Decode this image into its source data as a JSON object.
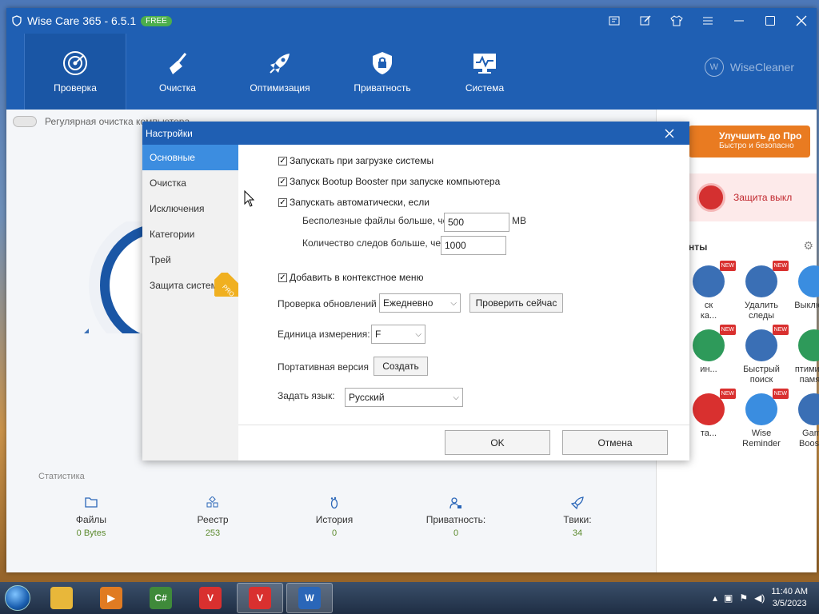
{
  "app": {
    "title": "Wise Care 365 - 6.5.1",
    "badge": "FREE",
    "brand": "WiseCleaner",
    "nav": [
      {
        "label": "Проверка",
        "icon": "radar-icon"
      },
      {
        "label": "Очистка",
        "icon": "broom-icon"
      },
      {
        "label": "Оптимизация",
        "icon": "rocket-icon"
      },
      {
        "label": "Приватность",
        "icon": "lock-shield-icon"
      },
      {
        "label": "Система",
        "icon": "monitor-icon"
      }
    ],
    "toggle_label": "Регулярная очистка компьютера",
    "stats_title": "Статистика",
    "stats": [
      {
        "label": "Файлы",
        "value": "0 Bytes",
        "icon": "folder-icon"
      },
      {
        "label": "Реестр",
        "value": "253",
        "icon": "registry-icon"
      },
      {
        "label": "История",
        "value": "0",
        "icon": "footprint-icon"
      },
      {
        "label": "Приватность:",
        "value": "0",
        "icon": "user-lock-icon"
      },
      {
        "label": "Твики:",
        "value": "34",
        "icon": "rocket-icon"
      }
    ],
    "upgrade": {
      "main": "Улучшить до Про",
      "sub": "Быстро и безопасно"
    },
    "protection": "Защита выкл",
    "tools_title": "нты",
    "tools": [
      {
        "label": "ск\nка...",
        "color": "#3a6fb5"
      },
      {
        "label": "Удалить\nследы",
        "color": "#3a6fb5"
      },
      {
        "label": "Выключ...",
        "color": "#3a8de0"
      },
      {
        "label": "ин...",
        "color": "#2e9a5a"
      },
      {
        "label": "Быстрый\nпоиск",
        "color": "#3a6fb5"
      },
      {
        "label": "птимизац\nпамяти",
        "color": "#2e9a5a"
      },
      {
        "label": "та...",
        "color": "#d9302f"
      },
      {
        "label": "Wise\nReminder",
        "color": "#3a8de0"
      },
      {
        "label": "Game\nBooster",
        "color": "#3a6fb5"
      }
    ],
    "new_badge": "NEW"
  },
  "dialog": {
    "title": "Настройки",
    "sidebar": [
      "Основные",
      "Очистка",
      "Исключения",
      "Категории",
      "Трей",
      "Защита системы"
    ],
    "pro_badge": "PRO",
    "options": {
      "startup": "Запускать при загрузке системы",
      "bootup_booster": "Запуск Bootup Booster при запуске компьютера",
      "auto_run": "Запускать автоматически, если",
      "junk_label": "Бесполезные файлы больше, чем",
      "junk_value": "500",
      "junk_unit": "MB",
      "traces_label": "Количество следов больше, чем",
      "traces_value": "1000",
      "context_menu": "Добавить в контекстное меню",
      "updates_label": "Проверка обновлений",
      "updates_value": "Ежедневно",
      "check_now": "Проверить сейчас",
      "unit_label": "Единица измерения:",
      "unit_value": "F",
      "portable_label": "Портативная версия",
      "create": "Создать",
      "lang_label": "Задать язык:",
      "lang_value": "Русский"
    },
    "ok": "OK",
    "cancel": "Отмена"
  },
  "taskbar": {
    "apps": [
      {
        "name": "explorer",
        "color": "#e8b73a",
        "glyph": ""
      },
      {
        "name": "media-player",
        "color": "#e07b22",
        "glyph": "▶"
      },
      {
        "name": "csharp",
        "color": "#3f8a3a",
        "glyph": "C#"
      },
      {
        "name": "vivaldi",
        "color": "#d9302f",
        "glyph": "V"
      },
      {
        "name": "vivaldi-2",
        "color": "#d9302f",
        "glyph": "V"
      },
      {
        "name": "wise-care",
        "color": "#2a66b8",
        "glyph": "W"
      }
    ],
    "time": "11:40 AM",
    "date": "3/5/2023"
  }
}
